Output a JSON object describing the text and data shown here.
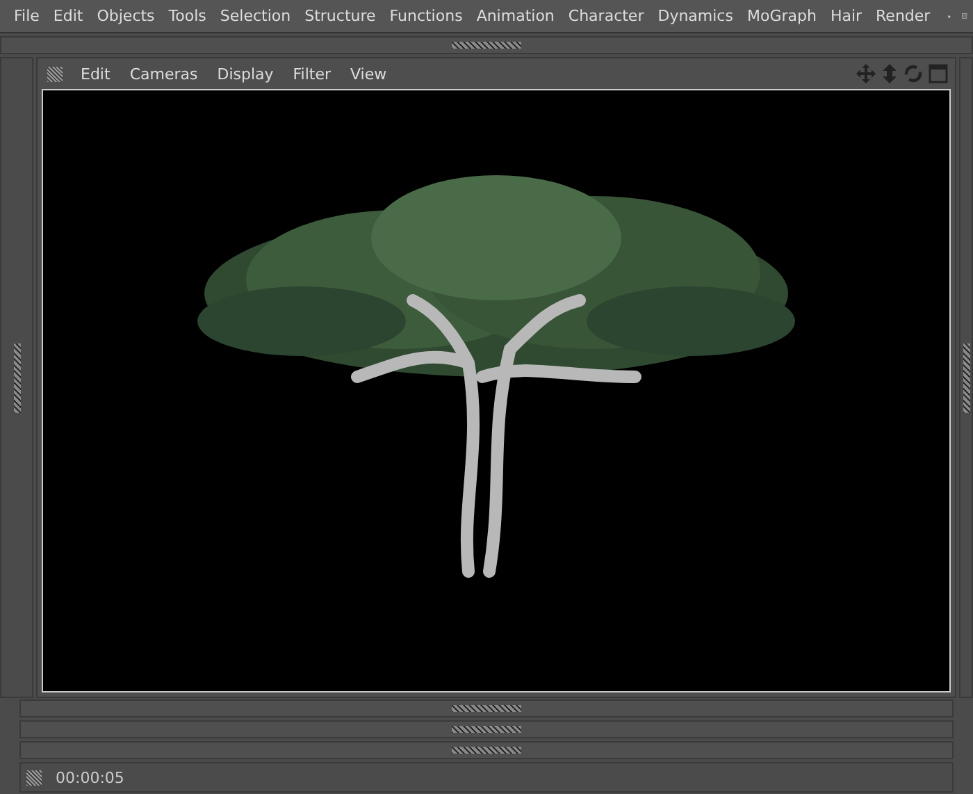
{
  "menu_bar": {
    "items": [
      "File",
      "Edit",
      "Objects",
      "Tools",
      "Selection",
      "Structure",
      "Functions",
      "Animation",
      "Character",
      "Dynamics",
      "MoGraph",
      "Hair",
      "Render"
    ]
  },
  "viewport": {
    "menu_items": [
      "Edit",
      "Cameras",
      "Display",
      "Filter",
      "View"
    ]
  },
  "status_bar": {
    "time": "00:00:05"
  }
}
